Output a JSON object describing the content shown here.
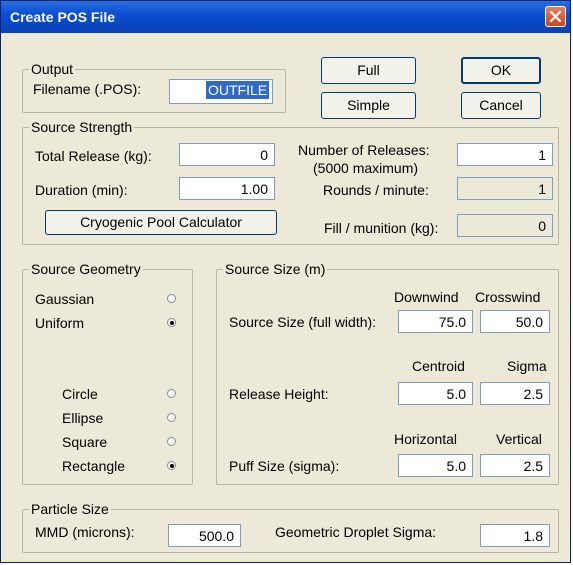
{
  "title": "Create POS File",
  "output": {
    "legend": "Output",
    "filename_label": "Filename (.POS):",
    "filename_value": "OUTFILE"
  },
  "buttons": {
    "full": "Full",
    "simple": "Simple",
    "ok": "OK",
    "cancel": "Cancel",
    "cryo": "Cryogenic Pool Calculator"
  },
  "strength": {
    "legend": "Source Strength",
    "total_release_label": "Total Release (kg):",
    "total_release": "0",
    "duration_label": "Duration (min):",
    "duration": "1.00",
    "num_releases_label": "Number of Releases:",
    "num_releases_note": "(5000 maximum)",
    "num_releases": "1",
    "rounds_label": "Rounds / minute:",
    "rounds": "1",
    "fill_label": "Fill / munition (kg):",
    "fill": "0"
  },
  "geometry": {
    "legend": "Source Geometry",
    "distribution": [
      {
        "label": "Gaussian",
        "selected": false
      },
      {
        "label": "Uniform",
        "selected": true
      }
    ],
    "shape": [
      {
        "label": "Circle",
        "selected": false
      },
      {
        "label": "Ellipse",
        "selected": false
      },
      {
        "label": "Square",
        "selected": false
      },
      {
        "label": "Rectangle",
        "selected": true
      }
    ]
  },
  "size": {
    "legend": "Source Size (m)",
    "h_downwind": "Downwind",
    "h_crosswind": "Crosswind",
    "source_size_label": "Source Size (full width):",
    "downwind": "75.0",
    "crosswind": "50.0",
    "h_centroid": "Centroid",
    "h_sigma": "Sigma",
    "release_height_label": "Release Height:",
    "centroid": "5.0",
    "sigma": "2.5",
    "h_horizontal": "Horizontal",
    "h_vertical": "Vertical",
    "puff_label": "Puff Size (sigma):",
    "horizontal": "5.0",
    "vertical": "2.5"
  },
  "particle": {
    "legend": "Particle Size",
    "mmd_label": "MMD (microns):",
    "mmd": "500.0",
    "gds_label": "Geometric Droplet Sigma:",
    "gds": "1.8"
  }
}
